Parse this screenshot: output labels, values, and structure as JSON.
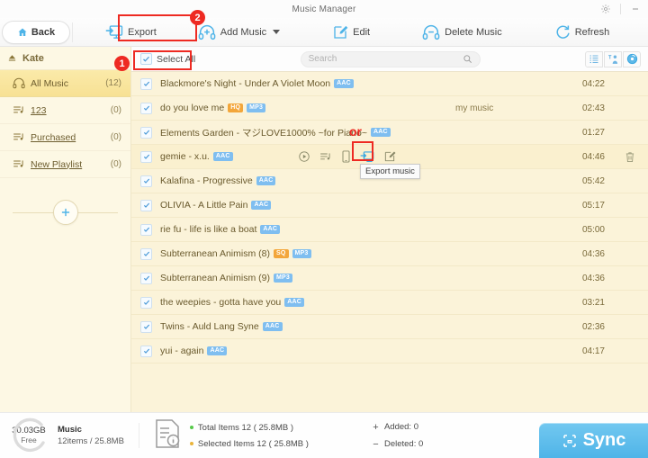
{
  "window": {
    "title": "Music Manager",
    "settings_icon": "gear-icon",
    "minimize_label": "—"
  },
  "toolbar": {
    "back_label": "Back",
    "items": [
      {
        "label": "Export",
        "icon": "export-icon"
      },
      {
        "label": "Add Music",
        "icon": "add-music-icon",
        "has_caret": true
      },
      {
        "label": "Edit",
        "icon": "edit-icon"
      },
      {
        "label": "Delete Music",
        "icon": "delete-music-icon"
      },
      {
        "label": "Refresh",
        "icon": "refresh-icon"
      }
    ]
  },
  "annotations": {
    "badge1": "1",
    "badge2": "2",
    "or_label": "or"
  },
  "sidebar": {
    "header": "Kate",
    "header_icon": "eject-icon",
    "items": [
      {
        "label": "All Music",
        "count": "(12)",
        "icon": "headphone-icon",
        "active": true,
        "underline": false
      },
      {
        "label": "123",
        "count": "(0)",
        "icon": "playlist-icon",
        "active": false,
        "underline": true
      },
      {
        "label": "Purchased",
        "count": "(0)",
        "icon": "playlist-icon",
        "active": false,
        "underline": true
      },
      {
        "label": "New Playlist",
        "count": "(0)",
        "icon": "playlist-icon",
        "active": false,
        "underline": true
      }
    ],
    "add_playlist_icon": "plus-icon"
  },
  "list_header": {
    "select_all_label": "Select All",
    "select_all_checked": true,
    "search_placeholder": "Search",
    "search_value": "",
    "search_icon": "search-icon",
    "view_modes": [
      {
        "icon": "list-view-icon",
        "active": false
      },
      {
        "icon": "artist-view-icon",
        "active": false
      },
      {
        "icon": "album-view-icon",
        "active": true
      }
    ]
  },
  "tracks": [
    {
      "title": "Blackmore's Night - Under A Violet Moon",
      "badges": [
        "AAC"
      ],
      "album": "",
      "duration": "04:22",
      "checked": true
    },
    {
      "title": "do you love me",
      "badges": [
        "HQ",
        "MP3"
      ],
      "album": "my music",
      "duration": "02:43",
      "checked": true
    },
    {
      "title": "Elements Garden - マジLOVE1000% ~for Piano~",
      "badges": [
        "AAC"
      ],
      "album": "",
      "duration": "01:27",
      "checked": true
    },
    {
      "title": "gemie - x.u.",
      "badges": [
        "AAC"
      ],
      "album": "",
      "duration": "04:46",
      "checked": true,
      "hover": true
    },
    {
      "title": "Kalafina - Progressive",
      "badges": [
        "AAC"
      ],
      "album": "",
      "duration": "05:42",
      "checked": true
    },
    {
      "title": "OLIVIA - A Little Pain",
      "badges": [
        "AAC"
      ],
      "album": "",
      "duration": "05:17",
      "checked": true
    },
    {
      "title": "rie fu - life is like a boat",
      "badges": [
        "AAC"
      ],
      "album": "",
      "duration": "05:00",
      "checked": true
    },
    {
      "title": "Subterranean Animism (8)",
      "badges": [
        "SQ",
        "MP3"
      ],
      "album": "",
      "duration": "04:36",
      "checked": true
    },
    {
      "title": "Subterranean Animism (9)",
      "badges": [
        "MP3"
      ],
      "album": "",
      "duration": "04:36",
      "checked": true
    },
    {
      "title": "the weepies - gotta have you",
      "badges": [
        "AAC"
      ],
      "album": "",
      "duration": "03:21",
      "checked": true
    },
    {
      "title": "Twins - Auld Lang Syne",
      "badges": [
        "AAC"
      ],
      "album": "",
      "duration": "02:36",
      "checked": true
    },
    {
      "title": "yui - again",
      "badges": [
        "AAC"
      ],
      "album": "",
      "duration": "04:17",
      "checked": true
    }
  ],
  "row_actions": {
    "icons": [
      "play-icon",
      "add-to-playlist-icon",
      "phone-icon",
      "export-music-icon",
      "edit-track-icon"
    ],
    "trash_icon": "trash-icon",
    "tooltip": "Export music"
  },
  "statusbar": {
    "storage_free": "30.03GB",
    "storage_free_label": "Free",
    "music_label": "Music",
    "music_detail": "12items / 25.8MB",
    "doc_icon": "info-doc-icon",
    "total_items": "Total Items 12 ( 25.8MB )",
    "selected_items": "Selected Items 12 ( 25.8MB )",
    "added": "Added: 0",
    "deleted": "Deleted: 0",
    "added_sign": "+",
    "deleted_sign": "−",
    "sync_label": "Sync",
    "sync_icon": "sync-icon"
  },
  "colors": {
    "accent_blue": "#4fb4e8",
    "cream": "#fbf3d9",
    "sidebar": "#fdf8e4",
    "annotation_red": "#ee2a22",
    "badge_blue": "#7fbef0",
    "badge_orange": "#f3a63a"
  }
}
